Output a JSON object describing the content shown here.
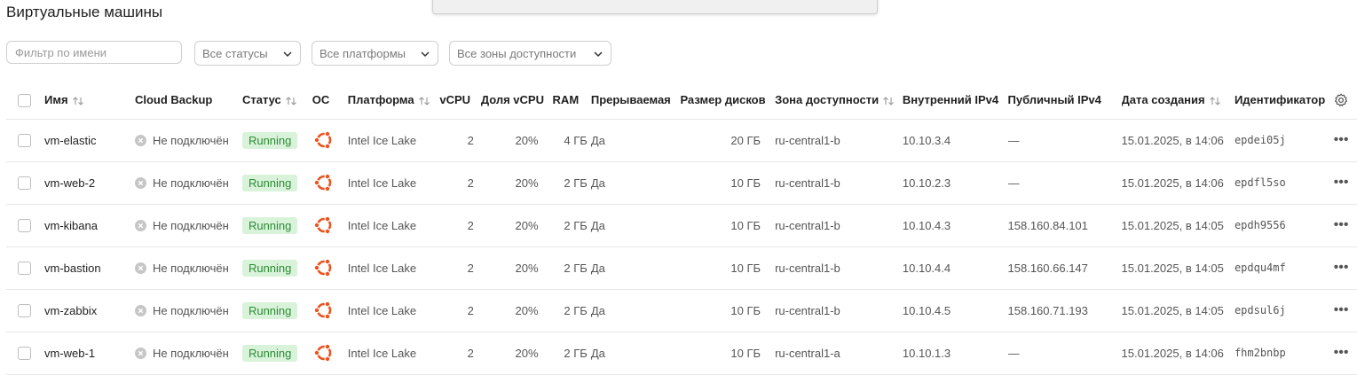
{
  "page": {
    "title": "Виртуальные машины"
  },
  "filters": {
    "name_placeholder": "Фильтр по имени",
    "status": "Все статусы",
    "platform": "Все платформы",
    "zone": "Все зоны доступности"
  },
  "table": {
    "columns": {
      "name": "Имя",
      "backup": "Cloud Backup",
      "status": "Статус",
      "os": "ОС",
      "platform": "Платформа",
      "vcpu": "vCPU",
      "vcpu_share": "Доля vCPU",
      "ram": "RAM",
      "preemptible": "Прерываемая",
      "disk": "Размер дисков",
      "zone": "Зона доступности",
      "ipv4_int": "Внутренний IPv4",
      "ipv4_pub": "Публичный IPv4",
      "created": "Дата создания",
      "id": "Идентификатор"
    },
    "rows": [
      {
        "name": "vm-elastic",
        "backup": "Не подключён",
        "status": "Running",
        "platform": "Intel Ice Lake",
        "vcpu": "2",
        "vcpu_share": "20%",
        "ram": "4 ГБ",
        "preemptible": "Да",
        "disk": "20 ГБ",
        "zone": "ru-central1-b",
        "ipv4_int": "10.10.3.4",
        "ipv4_pub": "—",
        "created": "15.01.2025, в 14:06",
        "id": "epdei05j"
      },
      {
        "name": "vm-web-2",
        "backup": "Не подключён",
        "status": "Running",
        "platform": "Intel Ice Lake",
        "vcpu": "2",
        "vcpu_share": "20%",
        "ram": "2 ГБ",
        "preemptible": "Да",
        "disk": "10 ГБ",
        "zone": "ru-central1-b",
        "ipv4_int": "10.10.2.3",
        "ipv4_pub": "—",
        "created": "15.01.2025, в 14:06",
        "id": "epdfl5so"
      },
      {
        "name": "vm-kibana",
        "backup": "Не подключён",
        "status": "Running",
        "platform": "Intel Ice Lake",
        "vcpu": "2",
        "vcpu_share": "20%",
        "ram": "2 ГБ",
        "preemptible": "Да",
        "disk": "10 ГБ",
        "zone": "ru-central1-b",
        "ipv4_int": "10.10.4.3",
        "ipv4_pub": "158.160.84.101",
        "created": "15.01.2025, в 14:05",
        "id": "epdh9556"
      },
      {
        "name": "vm-bastion",
        "backup": "Не подключён",
        "status": "Running",
        "platform": "Intel Ice Lake",
        "vcpu": "2",
        "vcpu_share": "20%",
        "ram": "2 ГБ",
        "preemptible": "Да",
        "disk": "10 ГБ",
        "zone": "ru-central1-b",
        "ipv4_int": "10.10.4.4",
        "ipv4_pub": "158.160.66.147",
        "created": "15.01.2025, в 14:05",
        "id": "epdqu4mf"
      },
      {
        "name": "vm-zabbix",
        "backup": "Не подключён",
        "status": "Running",
        "platform": "Intel Ice Lake",
        "vcpu": "2",
        "vcpu_share": "20%",
        "ram": "2 ГБ",
        "preemptible": "Да",
        "disk": "10 ГБ",
        "zone": "ru-central1-b",
        "ipv4_int": "10.10.4.5",
        "ipv4_pub": "158.160.71.193",
        "created": "15.01.2025, в 14:05",
        "id": "epdsul6j"
      },
      {
        "name": "vm-web-1",
        "backup": "Не подключён",
        "status": "Running",
        "platform": "Intel Ice Lake",
        "vcpu": "2",
        "vcpu_share": "20%",
        "ram": "2 ГБ",
        "preemptible": "Да",
        "disk": "10 ГБ",
        "zone": "ru-central1-a",
        "ipv4_int": "10.10.1.3",
        "ipv4_pub": "—",
        "created": "15.01.2025, в 14:06",
        "id": "fhm2bnbp"
      }
    ],
    "actions_label": "•••"
  },
  "colors": {
    "running_bg": "#d8f3d9",
    "running_text": "#2e8b36",
    "ubuntu": "#e95420"
  },
  "icons": {
    "sort": "sort-arrows-icon",
    "os": "ubuntu-icon",
    "backup": "x-circle-icon",
    "settings": "gear-icon"
  }
}
